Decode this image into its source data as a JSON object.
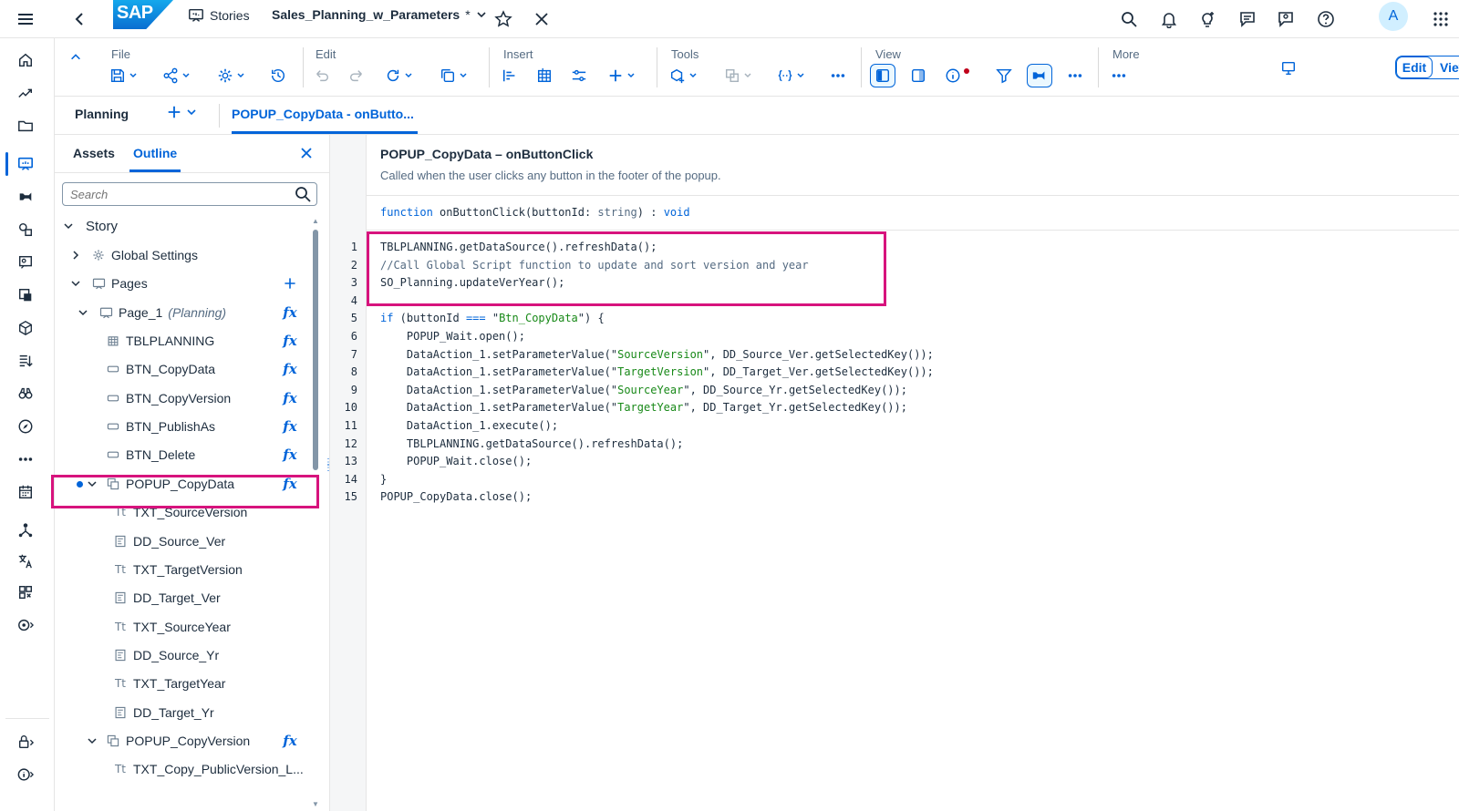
{
  "shell": {
    "stories_label": "Stories",
    "doc_title": "Sales_Planning_w_Parameters",
    "unsaved_marker": "*",
    "avatar_initial": "A",
    "logo_text": "SAP"
  },
  "toolbar": {
    "groups": {
      "file": "File",
      "edit": "Edit",
      "insert": "Insert",
      "tools": "Tools",
      "view": "View",
      "more": "More"
    },
    "edit_mode": "Edit",
    "view_mode": "View"
  },
  "tabbar": {
    "planning_label": "Planning",
    "active_tab": "POPUP_CopyData - onButto..."
  },
  "panel": {
    "tabs": {
      "assets": "Assets",
      "outline": "Outline"
    },
    "search_placeholder": "Search",
    "tree": [
      {
        "label": "Story"
      },
      {
        "label": "Global Settings"
      },
      {
        "label": "Pages"
      },
      {
        "label": "Page_1",
        "sub": "(Planning)"
      },
      {
        "label": "TBLPLANNING"
      },
      {
        "label": "BTN_CopyData"
      },
      {
        "label": "BTN_CopyVersion"
      },
      {
        "label": "BTN_PublishAs"
      },
      {
        "label": "BTN_Delete"
      },
      {
        "label": "POPUP_CopyData"
      },
      {
        "label": "TXT_SourceVersion"
      },
      {
        "label": "DD_Source_Ver"
      },
      {
        "label": "TXT_TargetVersion"
      },
      {
        "label": "DD_Target_Ver"
      },
      {
        "label": "TXT_SourceYear"
      },
      {
        "label": "DD_Source_Yr"
      },
      {
        "label": "TXT_TargetYear"
      },
      {
        "label": "DD_Target_Yr"
      },
      {
        "label": "POPUP_CopyVersion"
      },
      {
        "label": "TXT_Copy_PublicVersion_L..."
      }
    ],
    "fx_symbol": "fx"
  },
  "editor": {
    "function_title": "POPUP_CopyData – onButtonClick",
    "function_desc": "Called when the user clicks any button in the footer of the popup.",
    "signature": {
      "kw_function": "function",
      "name": " onButtonClick(buttonId: ",
      "param_type": "string",
      "close": ") : ",
      "return_type": "void"
    },
    "code_lines": [
      {
        "n": "1",
        "text": "TBLPLANNING.getDataSource().refreshData();"
      },
      {
        "n": "2",
        "text": "//Call Global Script function to update and sort version and year"
      },
      {
        "n": "3",
        "text": "SO_Planning.updateVerYear();"
      },
      {
        "n": "4",
        "text": ""
      },
      {
        "n": "5",
        "text": "if (buttonId === \"Btn_CopyData\") {"
      },
      {
        "n": "6",
        "text": "    POPUP_Wait.open();"
      },
      {
        "n": "7",
        "text": "    DataAction_1.setParameterValue(\"SourceVersion\", DD_Source_Ver.getSelectedKey());"
      },
      {
        "n": "8",
        "text": "    DataAction_1.setParameterValue(\"TargetVersion\", DD_Target_Ver.getSelectedKey());"
      },
      {
        "n": "9",
        "text": "    DataAction_1.setParameterValue(\"SourceYear\", DD_Source_Yr.getSelectedKey());"
      },
      {
        "n": "10",
        "text": "    DataAction_1.setParameterValue(\"TargetYear\", DD_Target_Yr.getSelectedKey());"
      },
      {
        "n": "11",
        "text": "    DataAction_1.execute();"
      },
      {
        "n": "12",
        "text": "    TBLPLANNING.getDataSource().refreshData();"
      },
      {
        "n": "13",
        "text": "    POPUP_Wait.close();"
      },
      {
        "n": "14",
        "text": "}"
      },
      {
        "n": "15",
        "text": "POPUP_CopyData.close();"
      }
    ]
  },
  "colors": {
    "accent": "#0064d9",
    "highlight": "#d7137d",
    "string": "#188918"
  }
}
